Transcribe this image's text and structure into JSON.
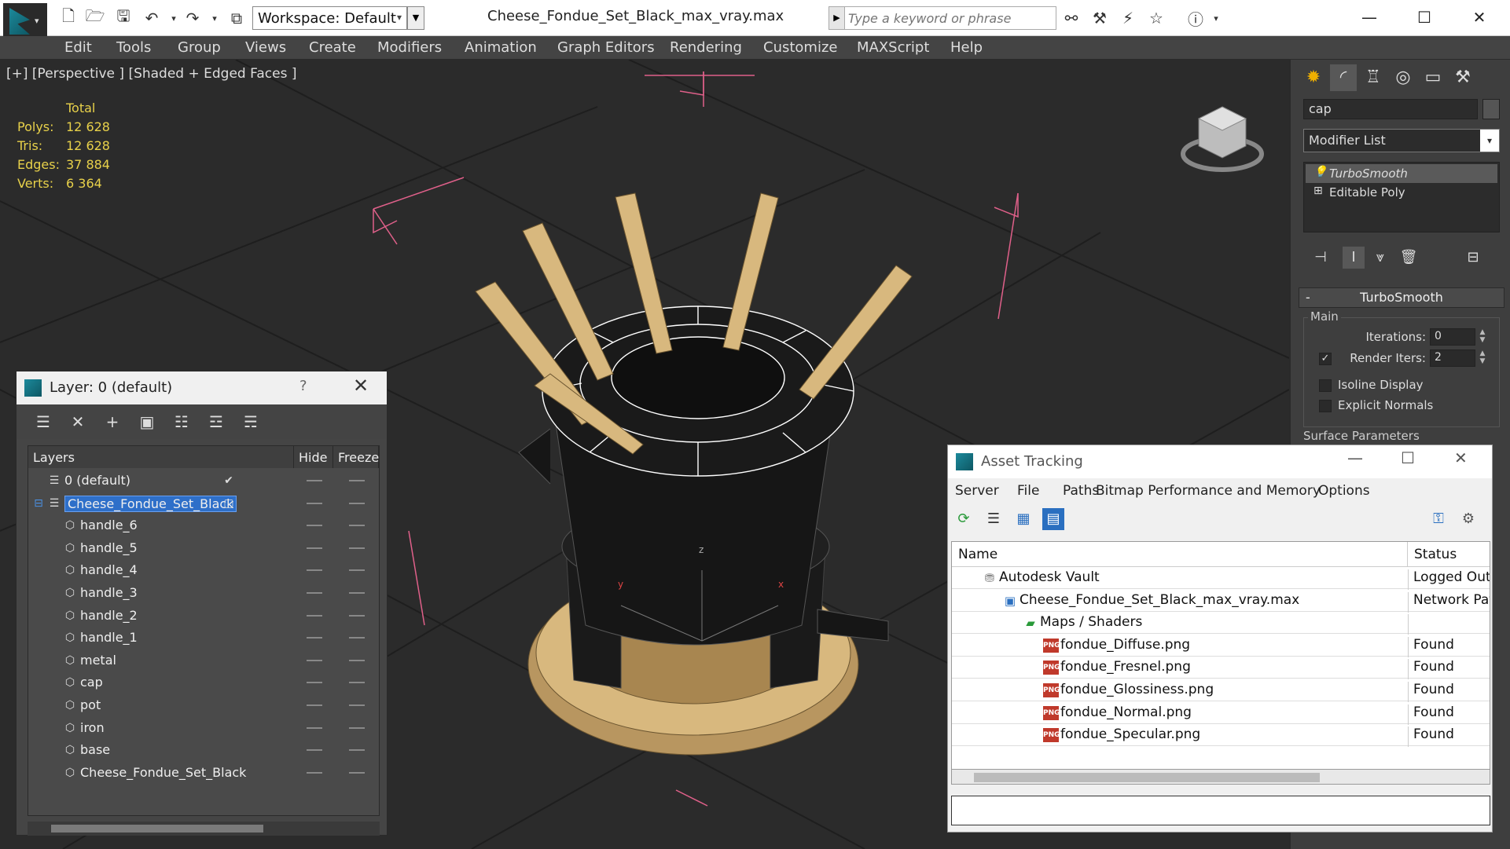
{
  "titlebar": {
    "workspace_label": "Workspace: Default",
    "file_title": "Cheese_Fondue_Set_Black_max_vray.max",
    "search_placeholder": "Type a keyword or phrase"
  },
  "menu": {
    "items": [
      "Edit",
      "Tools",
      "Group",
      "Views",
      "Create",
      "Modifiers",
      "Animation",
      "Graph Editors",
      "Rendering",
      "Customize",
      "MAXScript",
      "Help"
    ]
  },
  "viewport": {
    "label": "[+] [Perspective ] [Shaded + Edged Faces ]",
    "stats": {
      "header": "Total",
      "rows": [
        {
          "key": "Polys:",
          "value": "12 628"
        },
        {
          "key": "Tris:",
          "value": "12 628"
        },
        {
          "key": "Edges:",
          "value": "37 884"
        },
        {
          "key": "Verts:",
          "value": "6 364"
        }
      ]
    },
    "axis_labels": {
      "z": "z",
      "y": "y",
      "x": "x"
    }
  },
  "command_panel": {
    "object_name": "cap",
    "modifier_list_label": "Modifier List",
    "stack": [
      "TurboSmooth",
      "Editable Poly"
    ],
    "turbosmooth": {
      "title": "TurboSmooth",
      "collapse_symbol": "-",
      "main_label": "Main",
      "iterations_label": "Iterations:",
      "iterations_value": "0",
      "render_iters_label": "Render Iters:",
      "render_iters_value": "2",
      "render_iters_checked": true,
      "isoline_label": "Isoline Display",
      "explicit_normals_label": "Explicit Normals",
      "surface_params_label": "Surface Parameters"
    }
  },
  "layer_dialog": {
    "title": "Layer: 0 (default)",
    "help_label": "?",
    "columns": {
      "layers": "Layers",
      "hide": "Hide",
      "freeze": "Freeze"
    },
    "rows": [
      {
        "name": "0 (default)",
        "level": 0,
        "type": "layer",
        "active": true
      },
      {
        "name": "Cheese_Fondue_Set_Black",
        "level": 0,
        "type": "layer",
        "selected": true
      },
      {
        "name": "handle_6",
        "level": 1,
        "type": "object"
      },
      {
        "name": "handle_5",
        "level": 1,
        "type": "object"
      },
      {
        "name": "handle_4",
        "level": 1,
        "type": "object"
      },
      {
        "name": "handle_3",
        "level": 1,
        "type": "object"
      },
      {
        "name": "handle_2",
        "level": 1,
        "type": "object"
      },
      {
        "name": "handle_1",
        "level": 1,
        "type": "object"
      },
      {
        "name": "metal",
        "level": 1,
        "type": "object"
      },
      {
        "name": "cap",
        "level": 1,
        "type": "object"
      },
      {
        "name": "pot",
        "level": 1,
        "type": "object"
      },
      {
        "name": "iron",
        "level": 1,
        "type": "object"
      },
      {
        "name": "base",
        "level": 1,
        "type": "object"
      },
      {
        "name": "Cheese_Fondue_Set_Black",
        "level": 1,
        "type": "object"
      }
    ]
  },
  "asset_dialog": {
    "title": "Asset Tracking",
    "menu": [
      "Server",
      "File",
      "Paths",
      "Bitmap Performance and Memory",
      "Options"
    ],
    "columns": {
      "name": "Name",
      "status": "Status"
    },
    "rows": [
      {
        "name": "Autodesk Vault",
        "status": "Logged Out",
        "level": 1,
        "icon": "vault-icon"
      },
      {
        "name": "Cheese_Fondue_Set_Black_max_vray.max",
        "status": "Network Pat",
        "level": 2,
        "icon": "max-file-icon"
      },
      {
        "name": "Maps / Shaders",
        "status": "",
        "level": 3,
        "icon": "maps-folder-icon"
      },
      {
        "name": "fondue_Diffuse.png",
        "status": "Found",
        "level": 4,
        "icon": "png-file-icon"
      },
      {
        "name": "fondue_Fresnel.png",
        "status": "Found",
        "level": 4,
        "icon": "png-file-icon"
      },
      {
        "name": "fondue_Glossiness.png",
        "status": "Found",
        "level": 4,
        "icon": "png-file-icon"
      },
      {
        "name": "fondue_Normal.png",
        "status": "Found",
        "level": 4,
        "icon": "png-file-icon"
      },
      {
        "name": "fondue_Specular.png",
        "status": "Found",
        "level": 4,
        "icon": "png-file-icon"
      }
    ],
    "png_icon_text": "PNG"
  },
  "colors": {
    "stats_text": "#e8d14a",
    "selection_blue": "#2e6fc9",
    "bbox_pink": "#e0608a",
    "wood": "#d8b87e",
    "viewport_bg": "#2b2b2b"
  }
}
